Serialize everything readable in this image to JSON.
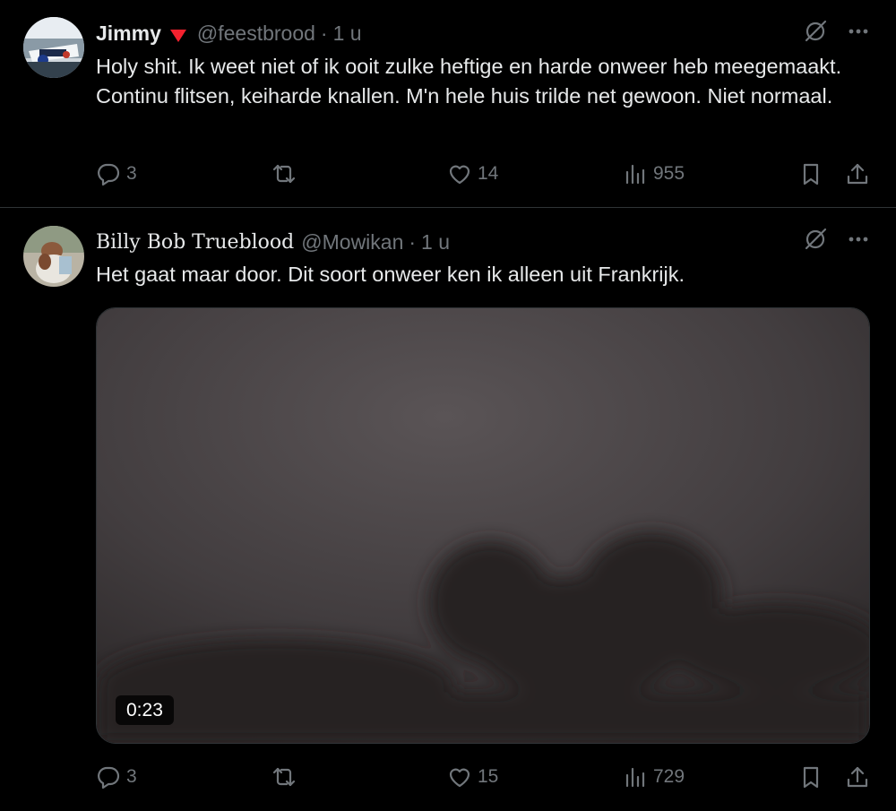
{
  "tweets": [
    {
      "author_name": "Jimmy",
      "verified_icon": "red-triangle-icon",
      "handle": "@feestbrood",
      "separator": "·",
      "time": "1 u",
      "text": "Holy shit. Ik weet niet of ik ooit zulke heftige en harde onweer heb meegemaakt. Continu flitsen, keiharde knallen. M'n hele huis trilde net gewoon. Niet normaal.",
      "replies": "3",
      "reposts": "",
      "likes": "14",
      "views": "955"
    },
    {
      "author_name": "Billy Bob Trueblood",
      "handle": "@Mowikan",
      "separator": "·",
      "time": "1 u",
      "text": "Het gaat maar door. Dit soort onweer ken ik alleen uit Frankrijk.",
      "video_duration": "0:23",
      "replies": "3",
      "reposts": "",
      "likes": "15",
      "views": "729"
    }
  ],
  "colors": {
    "background": "#000000",
    "text_primary": "#e7e9ea",
    "text_secondary": "#71767b",
    "divider": "#2f3336",
    "verified_triangle": "#f4212e"
  }
}
